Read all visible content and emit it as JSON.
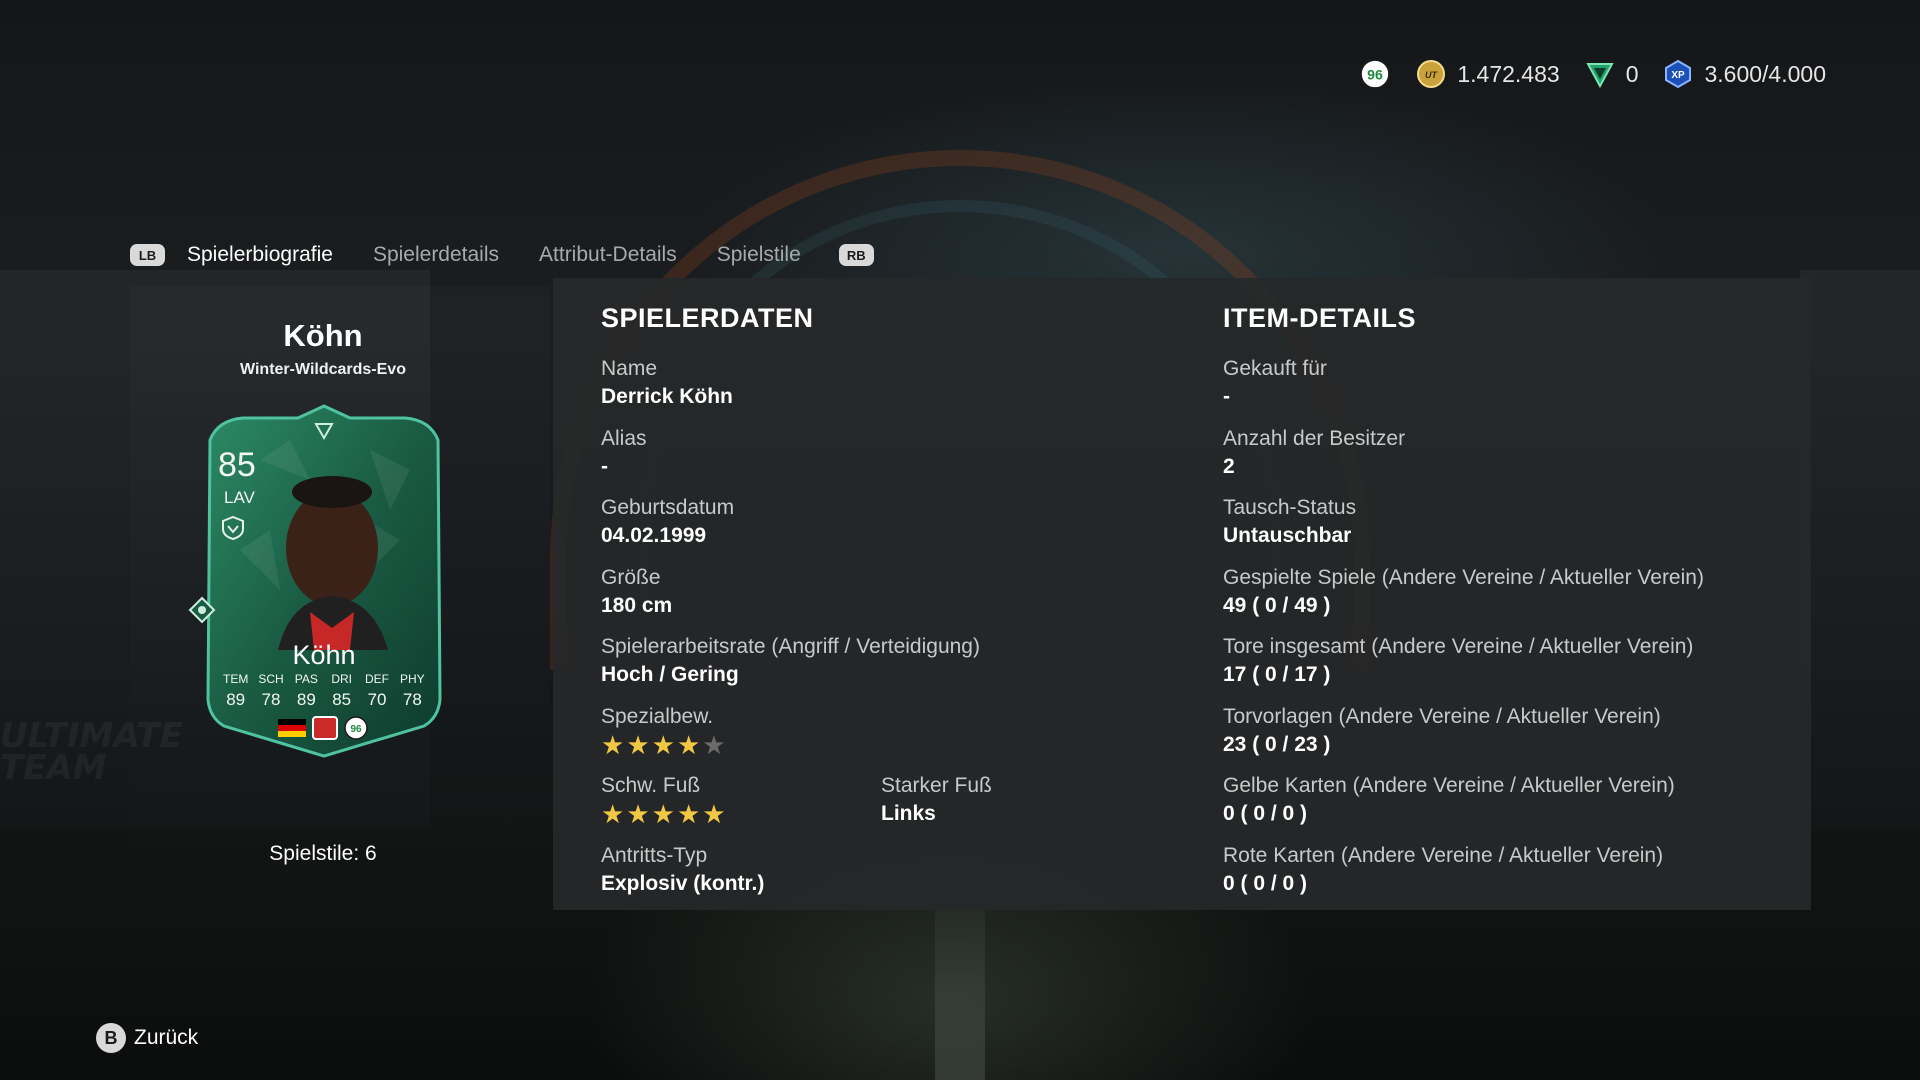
{
  "currency": {
    "club_icon": "club-crest-icon",
    "coins_icon": "coins-icon",
    "coins": "1.472.483",
    "points_icon": "fc-points-icon",
    "points": "0",
    "xp_icon": "xp-icon",
    "xp_label": "XP",
    "xp": "3.600/4.000"
  },
  "tabs": {
    "lb": "LB",
    "rb": "RB",
    "items": [
      "Spielerbiografie",
      "Spielerdetails",
      "Attribut-Details",
      "Spielstile"
    ],
    "active": "Spielerbiografie"
  },
  "player": {
    "name": "Köhn",
    "version": "Winter-Wildcards-Evo",
    "playstyles": "Spielstile: 6"
  },
  "card": {
    "rating": "85",
    "position": "LAV",
    "name": "Köhn",
    "stats": [
      {
        "label": "TEM",
        "value": "89"
      },
      {
        "label": "SCH",
        "value": "78"
      },
      {
        "label": "PAS",
        "value": "89"
      },
      {
        "label": "DRI",
        "value": "85"
      },
      {
        "label": "DEF",
        "value": "70"
      },
      {
        "label": "PHY",
        "value": "78"
      }
    ],
    "nation": "germany-flag",
    "league": "bundesliga-2-logo",
    "club": "hannover-96-crest",
    "club_text": "96",
    "colors": {
      "primary": "#1f6b4f",
      "accent": "#4fc3a0",
      "dark": "#0e3b2c"
    }
  },
  "spielerdaten": {
    "title": "SPIELERDATEN",
    "name_label": "Name",
    "name_value": "Derrick Köhn",
    "alias_label": "Alias",
    "alias_value": "-",
    "birth_label": "Geburtsdatum",
    "birth_value": "04.02.1999",
    "height_label": "Größe",
    "height_value": "180 cm",
    "workrate_label": "Spielerarbeitsrate (Angriff / Verteidigung)",
    "workrate_value": "Hoch / Gering",
    "skill_label": "Spezialbew.",
    "skill_stars": 4,
    "weakfoot_label": "Schw. Fuß",
    "weakfoot_stars": 5,
    "strongfoot_label": "Starker Fuß",
    "strongfoot_value": "Links",
    "accel_label": "Antritts-Typ",
    "accel_value": "Explosiv (kontr.)"
  },
  "itemdetails": {
    "title": "ITEM-DETAILS",
    "bought_label": "Gekauft für",
    "bought_value": "-",
    "owners_label": "Anzahl der Besitzer",
    "owners_value": "2",
    "trade_label": "Tausch-Status",
    "trade_value": "Untauschbar",
    "games_label": "Gespielte Spiele (Andere Vereine / Aktueller Verein)",
    "games_value": "49 ( 0 / 49 )",
    "goals_label": "Tore insgesamt (Andere Vereine / Aktueller Verein)",
    "goals_value": "17 ( 0 / 17 )",
    "assists_label": "Torvorlagen (Andere Vereine / Aktueller Verein)",
    "assists_value": "23 ( 0 / 23 )",
    "yellow_label": "Gelbe Karten (Andere Vereine / Aktueller Verein)",
    "yellow_value": "0 ( 0 / 0 )",
    "red_label": "Rote Karten (Andere Vereine / Aktueller Verein)",
    "red_value": "0 ( 0 / 0 )"
  },
  "footer": {
    "back_button": "B",
    "back_label": "Zurück"
  },
  "colors": {
    "star_on": "#f2c744",
    "star_off": "#6b6b6b",
    "panel": "#262829"
  }
}
